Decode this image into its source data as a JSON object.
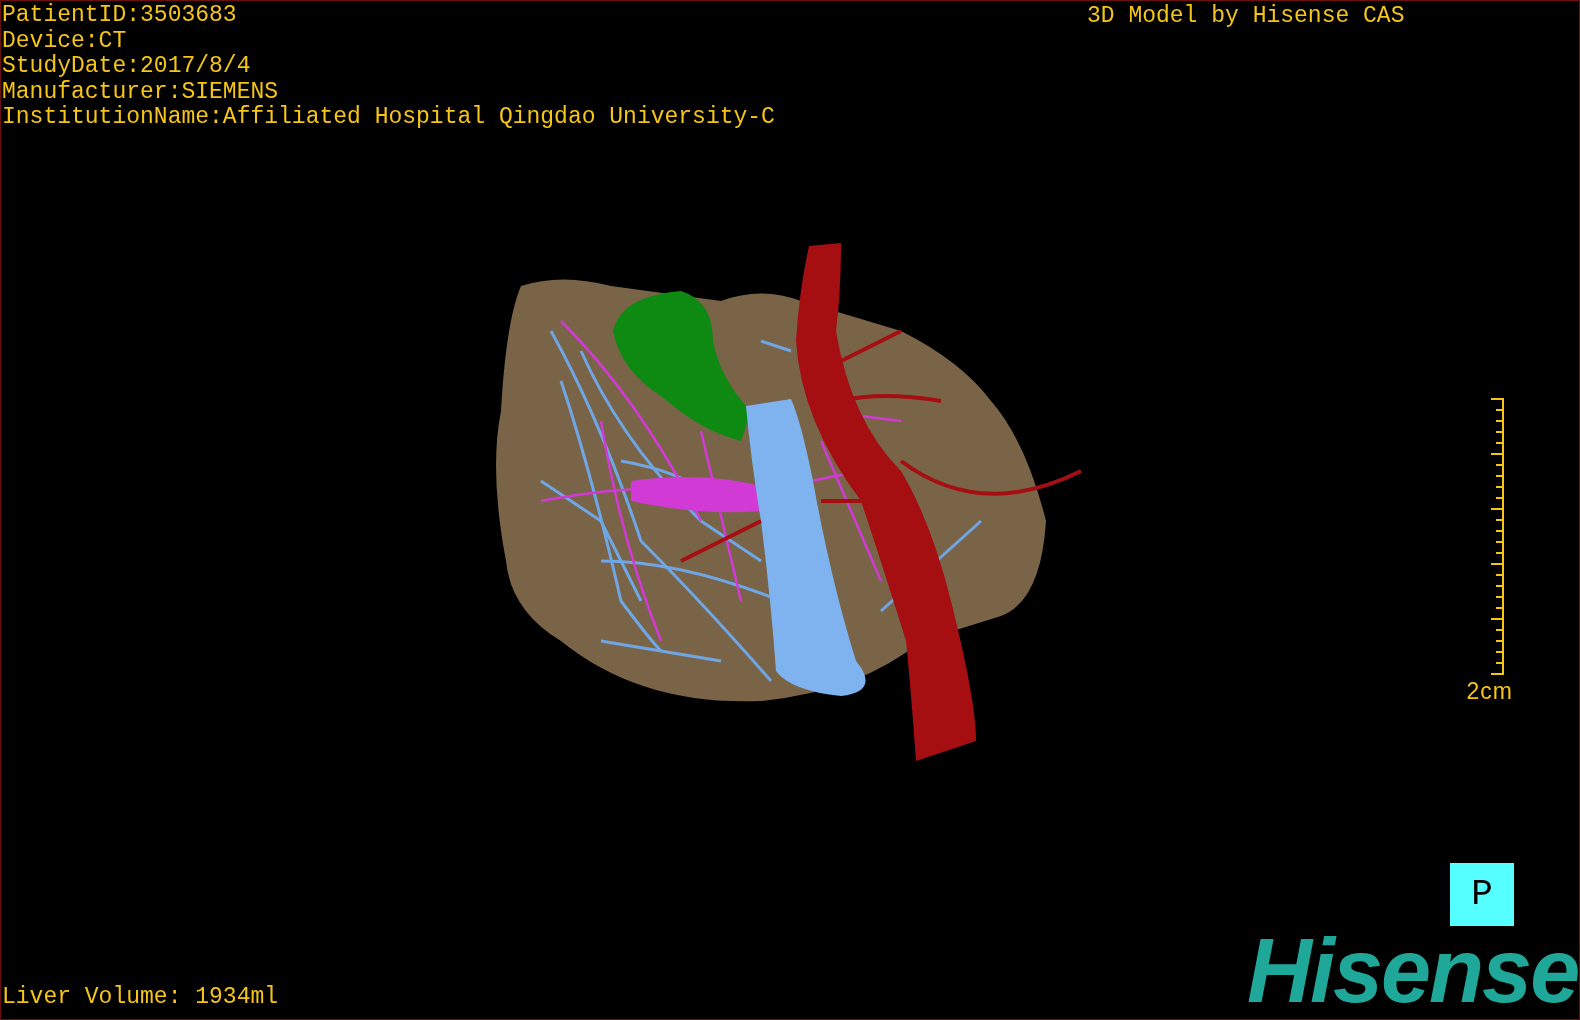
{
  "patient_info": [
    "PatientID:3503683",
    "Device:CT",
    "StudyDate:2017/8/4",
    "Manufacturer:SIEMENS",
    "InstitutionName:Affiliated Hospital Qingdao University-C"
  ],
  "title": "3D Model by Hisense CAS",
  "scale_bar": {
    "label": "2cm"
  },
  "orientation_marker": "P",
  "liver_volume": "Liver Volume: 1934ml",
  "logo": "Hisense"
}
